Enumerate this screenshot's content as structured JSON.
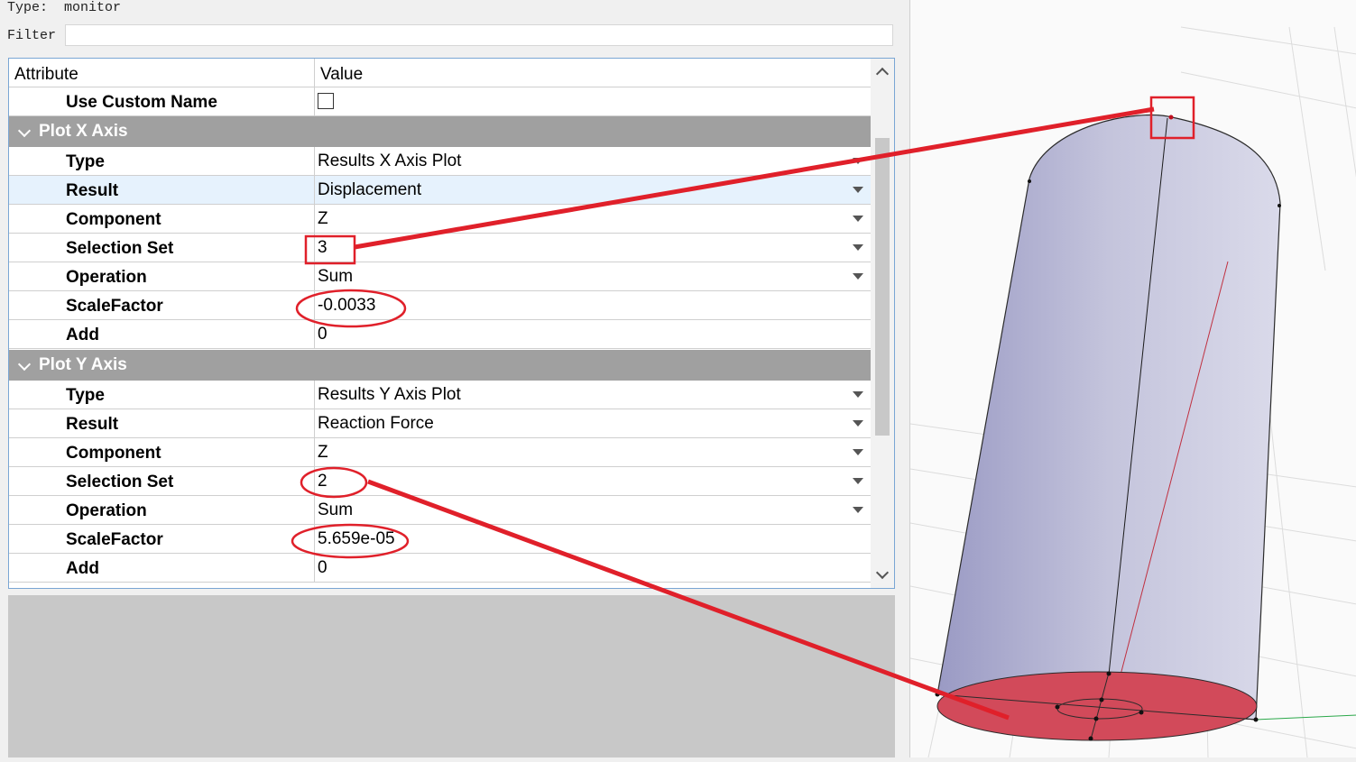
{
  "header": {
    "type_label": "Type:",
    "type_value": "monitor",
    "filter_label": "Filter",
    "filter_value": ""
  },
  "table": {
    "col_attribute": "Attribute",
    "col_value": "Value",
    "use_custom_name_label": "Use Custom Name",
    "use_custom_name_checked": false,
    "groups": [
      {
        "title": "Plot X Axis",
        "rows": [
          {
            "attr": "Type",
            "value": "Results X Axis Plot",
            "dropdown": true
          },
          {
            "attr": "Result",
            "value": "Displacement",
            "dropdown": true
          },
          {
            "attr": "Component",
            "value": "Z",
            "dropdown": true
          },
          {
            "attr": "Selection Set",
            "value": "3",
            "dropdown": true
          },
          {
            "attr": "Operation",
            "value": "Sum",
            "dropdown": true
          },
          {
            "attr": "ScaleFactor",
            "value": "-0.0033",
            "dropdown": false
          },
          {
            "attr": "Add",
            "value": "0",
            "dropdown": false
          }
        ]
      },
      {
        "title": "Plot Y Axis",
        "rows": [
          {
            "attr": "Type",
            "value": "Results Y Axis Plot",
            "dropdown": true
          },
          {
            "attr": "Result",
            "value": "Reaction Force",
            "dropdown": true
          },
          {
            "attr": "Component",
            "value": "Z",
            "dropdown": true
          },
          {
            "attr": "Selection Set",
            "value": "2",
            "dropdown": true
          },
          {
            "attr": "Operation",
            "value": "Sum",
            "dropdown": true
          },
          {
            "attr": "ScaleFactor",
            "value": "5.659e-05",
            "dropdown": false
          },
          {
            "attr": "Add",
            "value": "0",
            "dropdown": false
          }
        ]
      }
    ]
  },
  "colors": {
    "annotation_red": "#e0202a",
    "cylinder_fill": "#c5c5dd",
    "bottom_face": "#d24a5a",
    "group_header": "#a0a0a0"
  }
}
